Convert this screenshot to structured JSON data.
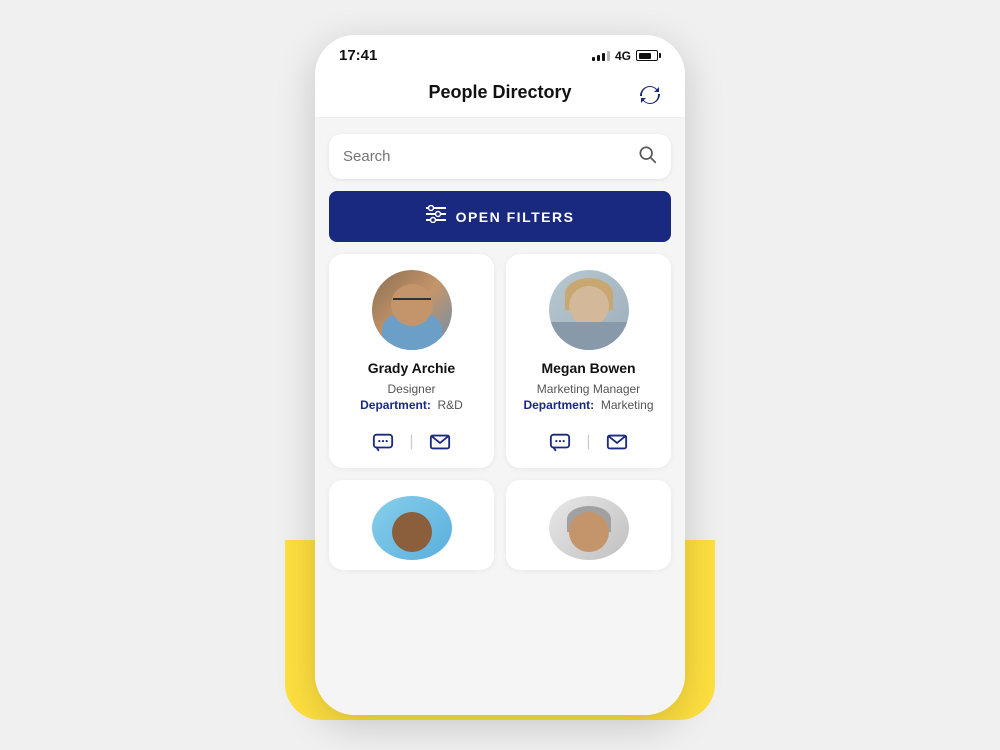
{
  "statusBar": {
    "time": "17:41",
    "network": "4G"
  },
  "header": {
    "title": "People Directory",
    "refreshLabel": "refresh"
  },
  "search": {
    "placeholder": "Search"
  },
  "filterButton": {
    "label": "OPEN FILTERS"
  },
  "people": [
    {
      "id": "grady",
      "name": "Grady Archie",
      "role": "Designer",
      "departmentLabel": "Department:",
      "department": "R&D"
    },
    {
      "id": "megan",
      "name": "Megan Bowen",
      "role": "Marketing Manager",
      "departmentLabel": "Department:",
      "department": "Marketing"
    }
  ],
  "colors": {
    "accent": "#1a2980",
    "yellow": "#FFE040",
    "white": "#ffffff"
  }
}
